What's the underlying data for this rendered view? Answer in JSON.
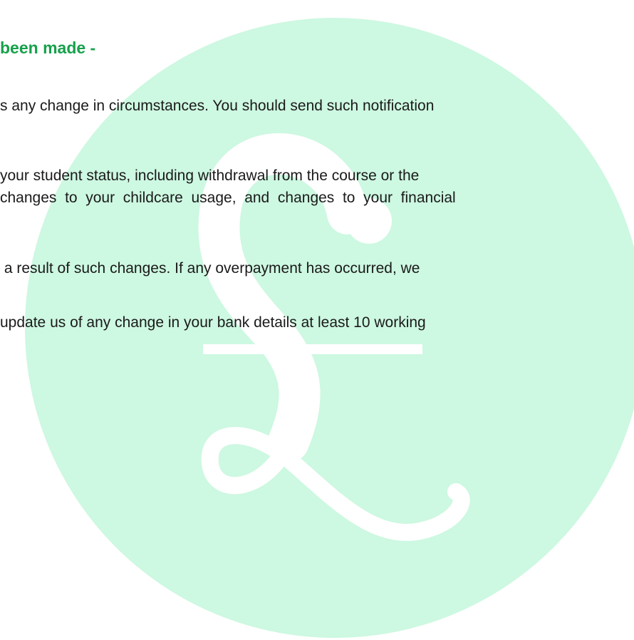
{
  "colors": {
    "heading": "#17a04b",
    "watermark_circle": "#cdf8e1",
    "watermark_symbol": "#ffffff",
    "text": "#1a1a1a"
  },
  "watermark": {
    "icon": "pound-sign-icon"
  },
  "document": {
    "heading": "been made -",
    "paragraphs": [
      {
        "lines": [
          "s any change in circumstances. You should send such notification"
        ]
      },
      {
        "lines": [
          "your student status, including withdrawal from the course or the",
          "changes  to  your  childcare  usage,  and  changes  to  your  financial"
        ]
      },
      {
        "lines": [
          " a result of such changes. If any overpayment has occurred, we"
        ]
      },
      {
        "lines": [
          "update us of any change in your bank details at least 10 working"
        ]
      }
    ]
  }
}
